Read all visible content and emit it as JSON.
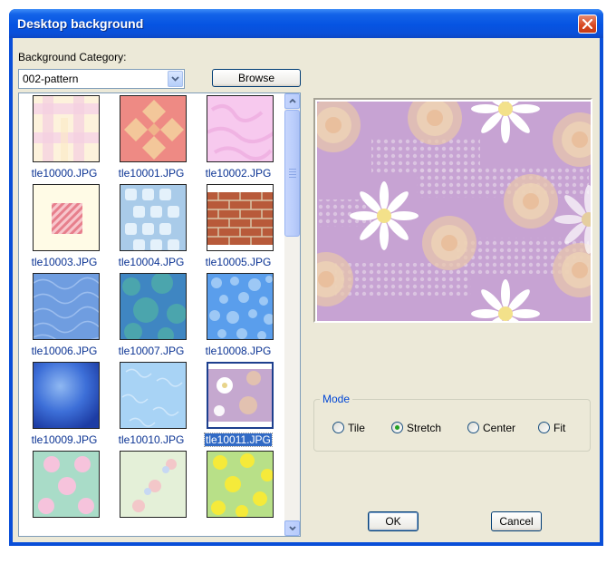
{
  "window": {
    "title": "Desktop background"
  },
  "category": {
    "label": "Background Category:",
    "value": "002-pattern"
  },
  "browse_label": "Browse",
  "thumbnails": [
    {
      "name": "tle10000.JPG"
    },
    {
      "name": "tle10001.JPG"
    },
    {
      "name": "tle10002.JPG"
    },
    {
      "name": "tle10003.JPG"
    },
    {
      "name": "tle10004.JPG"
    },
    {
      "name": "tle10005.JPG"
    },
    {
      "name": "tle10006.JPG"
    },
    {
      "name": "tle10007.JPG"
    },
    {
      "name": "tle10008.JPG"
    },
    {
      "name": "tle10009.JPG"
    },
    {
      "name": "tle10010.JPG"
    },
    {
      "name": "tle10011.JPG",
      "selected": true
    },
    {
      "name": ""
    },
    {
      "name": ""
    },
    {
      "name": ""
    }
  ],
  "mode": {
    "legend": "Mode",
    "options": [
      {
        "label": "Tile",
        "checked": false
      },
      {
        "label": "Stretch",
        "checked": true
      },
      {
        "label": "Center",
        "checked": false
      },
      {
        "label": "Fit",
        "checked": false
      }
    ]
  },
  "buttons": {
    "ok": "OK",
    "cancel": "Cancel"
  },
  "colors": {
    "title_bar": "#0a4fd8",
    "dialog_bg": "#ece9d8",
    "selection": "#316ac5",
    "file_label": "#0b3393"
  },
  "icons": {
    "close": "close-icon",
    "dropdown": "chevron-down-icon",
    "scroll_up": "arrow-up-icon",
    "scroll_down": "arrow-down-icon"
  }
}
